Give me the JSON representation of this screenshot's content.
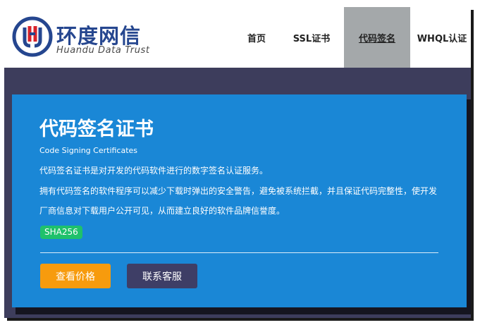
{
  "brand": {
    "name_cn": "环度网信",
    "name_en": "Huandu Data Trust",
    "colors": {
      "primary": "#25468f",
      "accent_red": "#d8232a"
    }
  },
  "nav": {
    "items": [
      {
        "label": "首页",
        "active": false
      },
      {
        "label": "SSL证书",
        "active": false
      },
      {
        "label": "代码签名",
        "active": true
      },
      {
        "label": "WHQL认证",
        "active": false
      }
    ]
  },
  "hero": {
    "title": "代码签名证书",
    "subtitle": "Code Signing Certificates",
    "lines": [
      "代码签名证书是对开发的代码软件进行的数字签名认证服务。",
      "拥有代码签名的软件程序可以减少下载时弹出的安全警告，避免被系统拦截，并且保证代码完整性，使开发",
      "厂商信息对下载用户公开可见，从而建立良好的软件品牌信誉度。"
    ],
    "badge": "SHA256",
    "buttons": {
      "price": "查看价格",
      "contact": "联系客服"
    },
    "colors": {
      "card_bg": "#1a87d6",
      "badge_bg": "#1fc16b",
      "price_btn": "#f79b0d",
      "contact_btn": "#3e3e66",
      "page_bg": "#3d3d5c"
    }
  }
}
